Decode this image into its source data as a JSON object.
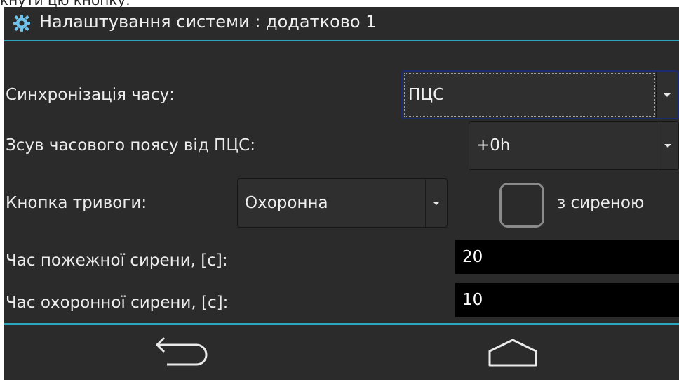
{
  "top_caption": "кнути цю кнопку.",
  "window": {
    "title": "Налаштування системи : додатково 1"
  },
  "form": {
    "time_sync": {
      "label": "Синхронізація часу:",
      "value": "ПЦС"
    },
    "tz_offset": {
      "label": "Зсув часового поясу від ПЦС:",
      "value": "+0h"
    },
    "alarm_button": {
      "label": "Кнопка тривоги:",
      "value": "Охоронна",
      "siren_checkbox_label": "з сиреною",
      "siren_checked": false
    },
    "fire_siren_time": {
      "label": "Час пожежної сирени, [с]:",
      "value": "20"
    },
    "security_siren_time": {
      "label": "Час охоронної сирени, [с]:",
      "value": "10"
    }
  },
  "colors": {
    "accent": "#2ca6bd",
    "background": "#2b2b2b",
    "field_bg": "#000000"
  },
  "icons": {
    "title": "gear-icon",
    "back": "back-arrow-icon",
    "home": "home-icon"
  }
}
